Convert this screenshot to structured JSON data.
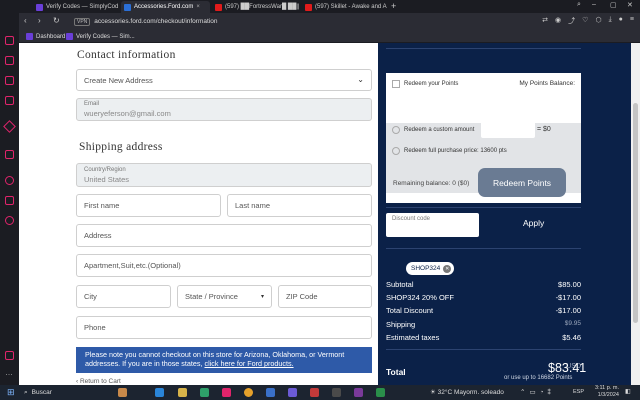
{
  "browser": {
    "tabs": [
      {
        "label": "Verify Codes — SimplyCod",
        "favicon": "purple"
      },
      {
        "label": "Accessories.Ford.com",
        "favicon": "ford"
      },
      {
        "label": "(597) ██FortressWar█ ██||",
        "favicon": "yt"
      },
      {
        "label": "(597) Skillet - Awake and A",
        "favicon": "yt"
      }
    ],
    "new_tab": "+",
    "url": "accessories.ford.com/checkout/information",
    "vpn": "VPN",
    "bookmarks": [
      "Dashboard",
      "Verify Codes — Sim..."
    ]
  },
  "checkout": {
    "contact_heading": "Contact information",
    "address_select": "Create New Address",
    "email_label": "Email",
    "email_value": "wueryeferson@gmail.com",
    "shipping_heading": "Shipping address",
    "country_label": "Country/Region",
    "country_value": "United States",
    "first_name_ph": "First name",
    "last_name_ph": "Last name",
    "address_ph": "Address",
    "apartment_ph": "Apartment,Suit,etc.(Optional)",
    "city_ph": "City",
    "state_ph": "State / Province",
    "zip_ph": "ZIP Code",
    "phone_ph": "Phone",
    "notice_text": "Please note you cannot checkout on this store for Arizona, Oklahoma, or Vermont addresses. If you are in those states,",
    "notice_link": "click here for Ford products.",
    "back_link": "Return to Cart"
  },
  "points": {
    "redeem_label": "Redeem your Points",
    "balance_label": "My Points Balance:",
    "custom_amount_label": "Redeem a custom amount",
    "custom_amount_value": "= $0",
    "full_price_label": "Redeem full purchase price: 13600 pts",
    "remaining": "Remaining balance: 0 ($0)",
    "redeem_button": "Redeem Points"
  },
  "discount": {
    "placeholder": "Discount code",
    "apply": "Apply",
    "chip": "SHOP324"
  },
  "summary": {
    "rows": [
      {
        "label": "Subtotal",
        "value": "$85.00"
      },
      {
        "label": "SHOP324 20% OFF",
        "value": "-$17.00"
      },
      {
        "label": "Total Discount",
        "value": "-$17.00"
      },
      {
        "label": "Shipping",
        "value": "$9.95"
      },
      {
        "label": "Estimated taxes",
        "value": "$5.46"
      }
    ],
    "total_label": "Total",
    "currency": "USD",
    "total_value": "$83.41",
    "points_note": "or use up to 16682 Points"
  },
  "taskbar": {
    "search": "Buscar",
    "weather": "32°C  Mayorm. soleado",
    "lang": "ESP",
    "time": "3:11 p. m.",
    "date": "1/3/2024"
  }
}
